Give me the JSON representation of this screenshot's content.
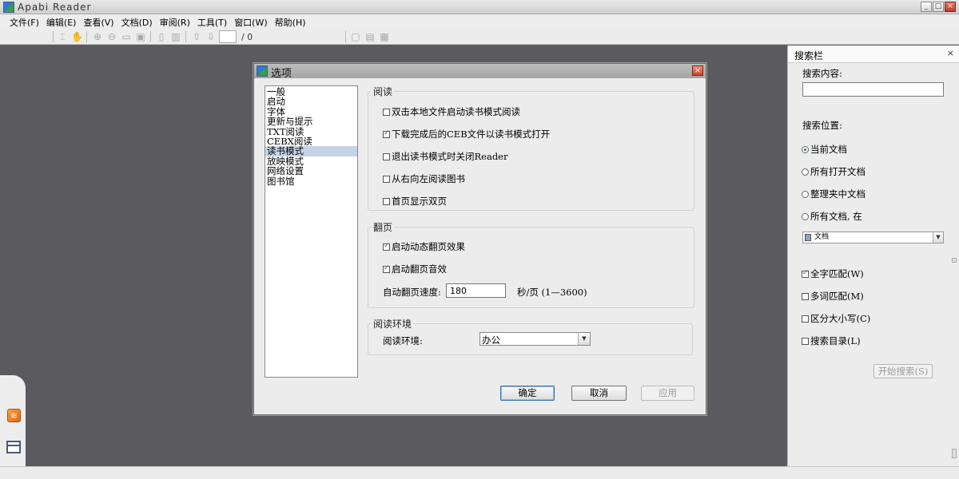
{
  "window": {
    "title": "Apabi Reader"
  },
  "window_controls": {
    "minimize": "_",
    "maximize": "□",
    "close": "×"
  },
  "menu": [
    "文件(F)",
    "编辑(E)",
    "查看(V)",
    "文档(D)",
    "审阅(R)",
    "工具(T)",
    "窗口(W)",
    "帮助(H)"
  ],
  "toolbar": {
    "page_current": "",
    "page_total": "/ 0"
  },
  "dialog": {
    "title": "选项",
    "close_glyph": "×",
    "categories": [
      "一般",
      "启动",
      "字体",
      "更新与提示",
      "TXT阅读",
      "CEBX阅读",
      "读书模式",
      "放映模式",
      "网络设置",
      "图书馆"
    ],
    "selected_category": "读书模式",
    "reading_group": {
      "label": "阅读",
      "options": [
        {
          "label": "双击本地文件启动读书模式阅读",
          "checked": false
        },
        {
          "label": "下载完成后的CEB文件以读书模式打开",
          "checked": true
        },
        {
          "label": "退出读书模式时关闭Reader",
          "checked": false
        },
        {
          "label": "从右向左阅读图书",
          "checked": false
        },
        {
          "label": "首页显示双页",
          "checked": false
        }
      ]
    },
    "page_turn_group": {
      "label": "翻页",
      "options": [
        {
          "label": "启动动态翻页效果",
          "checked": true
        },
        {
          "label": "启动翻页音效",
          "checked": true
        }
      ],
      "speed_label": "自动翻页速度:",
      "speed_value": "180",
      "speed_unit": "秒/页 (1—3600)"
    },
    "env_group": {
      "label": "阅读环境",
      "field_label": "阅读环境:",
      "selected": "办公"
    },
    "buttons": {
      "ok": "确定",
      "cancel": "取消",
      "apply": "应用"
    }
  },
  "search_panel": {
    "title": "搜索栏",
    "close_glyph": "×",
    "content_label": "搜索内容:",
    "query": "",
    "location_label": "搜索位置:",
    "locations": [
      {
        "label": "当前文档",
        "selected": true
      },
      {
        "label": "所有打开文档",
        "selected": false
      },
      {
        "label": "整理夹中文档",
        "selected": false
      },
      {
        "label": "所有文档, 在",
        "selected": false
      }
    ],
    "folder_select": "文档",
    "options": [
      {
        "label": "全字匹配(W)",
        "checked": true
      },
      {
        "label": "多词匹配(M)",
        "checked": false
      },
      {
        "label": "区分大小写(C)",
        "checked": false
      },
      {
        "label": "搜索目录(L)",
        "checked": false
      }
    ],
    "start_button": "开始搜索(S)"
  },
  "sidebar_icons": {
    "rss_glyph": "≋"
  },
  "colors": {
    "workspace": "#5a5a5f",
    "selection": "#c4d3e6",
    "check": "#2e7d32",
    "close": "#c0392b"
  }
}
